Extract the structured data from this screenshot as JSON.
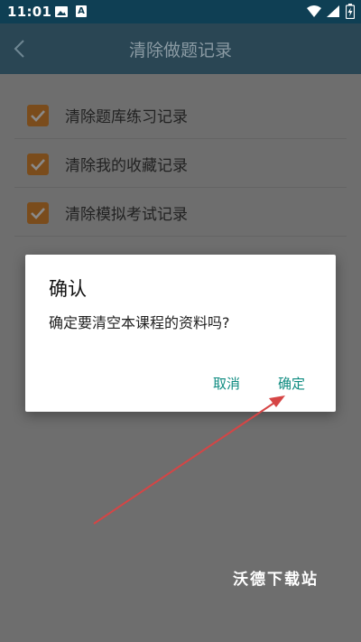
{
  "status_bar": {
    "time": "11:01",
    "notification_icons": [
      "image-icon",
      "a-app-icon"
    ],
    "system_icons": [
      "wifi-icon",
      "signal-icon",
      "battery-charging-icon"
    ],
    "a_icon_text": "A"
  },
  "app_bar": {
    "title": "清除做题记录",
    "back_icon": "chevron-left-icon"
  },
  "options": [
    {
      "label": "清除题库练习记录",
      "checked": true
    },
    {
      "label": "清除我的收藏记录",
      "checked": true
    },
    {
      "label": "清除模拟考试记录",
      "checked": true
    }
  ],
  "dialog": {
    "title": "确认",
    "message": "确定要清空本课程的资料吗?",
    "cancel_label": "取消",
    "confirm_label": "确定"
  },
  "watermark": "沃德下载站",
  "colors": {
    "status_bar": "#0f3f54",
    "accent": "#0e8b80",
    "checkbox": "#7a4c1c",
    "arrow": "#d64545"
  }
}
